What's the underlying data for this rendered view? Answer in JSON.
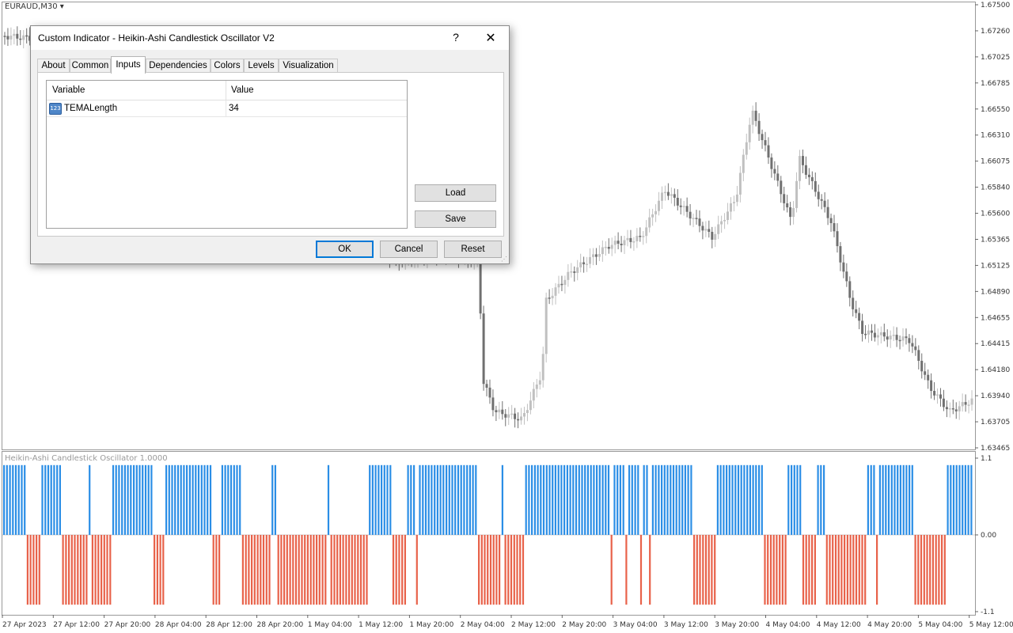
{
  "chart": {
    "symbol": "EURAUD,M30",
    "price_scale": [
      "1.67500",
      "1.67260",
      "1.67025",
      "1.66785",
      "1.66550",
      "1.66310",
      "1.66075",
      "1.65840",
      "1.65600",
      "1.65365",
      "1.65125",
      "1.64890",
      "1.64655",
      "1.64415",
      "1.64180",
      "1.63940",
      "1.63705",
      "1.63465"
    ],
    "time_labels": [
      "27 Apr 2023",
      "27 Apr 12:00",
      "27 Apr 20:00",
      "28 Apr 04:00",
      "28 Apr 12:00",
      "28 Apr 20:00",
      "1 May 04:00",
      "1 May 12:00",
      "1 May 20:00",
      "2 May 04:00",
      "2 May 12:00",
      "2 May 20:00",
      "3 May 04:00",
      "3 May 12:00",
      "3 May 20:00",
      "4 May 04:00",
      "4 May 12:00",
      "4 May 20:00",
      "5 May 04:00",
      "5 May 12:00"
    ],
    "candle_colors": {
      "bull": "#c0c0c0",
      "bear": "#707070"
    },
    "indicator": {
      "title": "Heikin-Ashi Candlestick Oscillator 1.0000",
      "scale": [
        "1.1",
        "0.00",
        "-1.1"
      ],
      "colors": {
        "up": "#2b8ee6",
        "down": "#e8624a"
      }
    }
  },
  "chart_data": {
    "type": "bar",
    "title": "Heikin-Ashi Candlestick Oscillator 1.0000",
    "ylim": [
      -1.1,
      1.1
    ],
    "series": [
      {
        "values": [
          1,
          1,
          1,
          1,
          1,
          1,
          1,
          1,
          -1,
          -1,
          -1,
          -1,
          -1,
          1,
          1,
          1,
          1,
          1,
          1,
          1,
          -1,
          -1,
          -1,
          -1,
          -1,
          -1,
          -1,
          -1,
          -1,
          1,
          -1,
          -1,
          -1,
          -1,
          -1,
          -1,
          -1,
          1,
          1,
          1,
          1,
          1,
          1,
          1,
          1,
          1,
          1,
          1,
          1,
          1,
          1,
          -1,
          -1,
          -1,
          -1,
          1,
          1,
          1,
          1,
          1,
          1,
          1,
          1,
          1,
          1,
          1,
          1,
          1,
          1,
          1,
          1,
          -1,
          -1,
          -1,
          1,
          1,
          1,
          1,
          1,
          1,
          1,
          -1,
          -1,
          -1,
          -1,
          -1,
          -1,
          -1,
          -1,
          -1,
          -1,
          1,
          1,
          -1,
          -1,
          -1,
          -1,
          -1,
          -1,
          -1,
          -1,
          -1,
          -1,
          -1,
          -1,
          -1,
          -1,
          -1,
          -1,
          -1,
          1,
          -1,
          -1,
          -1,
          -1,
          -1,
          -1,
          -1,
          -1,
          -1,
          -1,
          -1,
          -1,
          -1,
          1,
          1,
          1,
          1,
          1,
          1,
          1,
          1,
          -1,
          -1,
          -1,
          -1,
          -1,
          1,
          1,
          1,
          -1,
          1,
          1,
          1,
          1,
          1,
          1,
          1,
          1,
          1,
          1,
          1,
          1,
          1,
          1,
          1,
          1,
          1,
          1,
          1,
          1,
          -1,
          -1,
          -1,
          -1,
          -1,
          -1,
          -1,
          -1,
          1,
          -1,
          -1,
          -1,
          -1,
          -1,
          -1,
          -1,
          1,
          1,
          1,
          1,
          1,
          1,
          1,
          1,
          1,
          1,
          1,
          1,
          1,
          1,
          1,
          1,
          1,
          1,
          1,
          1,
          1,
          1,
          1,
          1,
          1,
          1,
          1,
          1,
          1,
          -1,
          1,
          1,
          1,
          1,
          -1,
          1,
          1,
          1,
          1,
          -1,
          1,
          1,
          -1,
          1,
          1,
          1,
          1,
          1,
          1,
          1,
          1,
          1,
          1,
          1,
          1,
          1,
          1,
          -1,
          -1,
          -1,
          -1,
          -1,
          -1,
          -1,
          -1,
          1,
          1,
          1,
          1,
          1,
          1,
          1,
          1,
          1,
          1,
          1,
          1,
          1,
          1,
          1,
          1,
          -1,
          -1,
          -1,
          -1,
          -1,
          -1,
          -1,
          -1,
          1,
          1,
          1,
          1,
          1,
          -1,
          -1,
          -1,
          -1,
          -1,
          1,
          1,
          1,
          -1,
          -1,
          -1,
          -1,
          -1,
          -1,
          -1,
          -1,
          -1,
          -1,
          -1,
          -1,
          -1,
          -1,
          1,
          1,
          1,
          -1,
          1,
          1,
          1,
          1,
          1,
          1,
          1,
          1,
          1,
          1,
          1,
          1,
          -1,
          -1,
          -1,
          -1,
          -1,
          -1,
          -1,
          -1,
          -1,
          -1,
          -1,
          1,
          1,
          1,
          1,
          1,
          1,
          1,
          1,
          1
        ]
      }
    ]
  },
  "dialog": {
    "title": "Custom Indicator - Heikin-Ashi Candlestick Oscillator V2",
    "help": "?",
    "close": "✕",
    "tabs": [
      {
        "label": "About",
        "active": false
      },
      {
        "label": "Common",
        "active": false
      },
      {
        "label": "Inputs",
        "active": true
      },
      {
        "label": "Dependencies",
        "active": false
      },
      {
        "label": "Colors",
        "active": false
      },
      {
        "label": "Levels",
        "active": false
      },
      {
        "label": "Visualization",
        "active": false
      }
    ],
    "grid": {
      "col_variable": "Variable",
      "col_value": "Value",
      "rows": [
        {
          "icon": "123",
          "name": "TEMALength",
          "value": "34"
        }
      ]
    },
    "buttons": {
      "load": "Load",
      "save": "Save",
      "ok": "OK",
      "cancel": "Cancel",
      "reset": "Reset"
    }
  }
}
